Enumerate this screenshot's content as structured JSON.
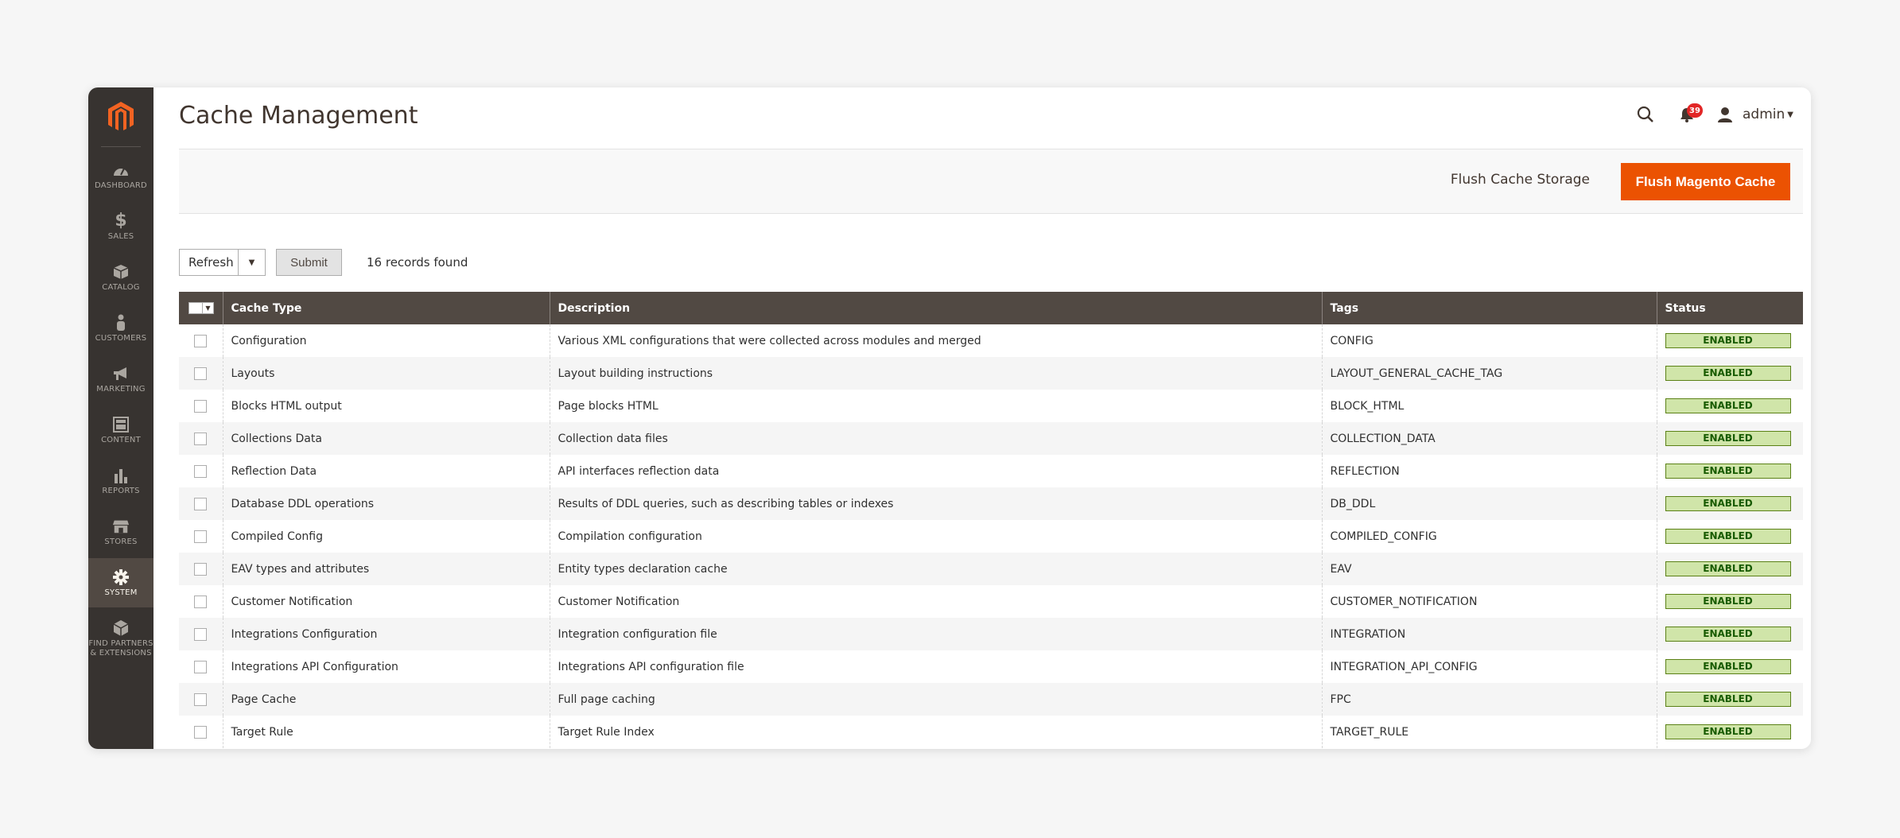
{
  "page": {
    "title": "Cache Management"
  },
  "header": {
    "notifications_count": "39",
    "user_name": "admin"
  },
  "sidebar": {
    "items": [
      {
        "label": "DASHBOARD",
        "icon": "dashboard-icon"
      },
      {
        "label": "SALES",
        "icon": "dollar-icon"
      },
      {
        "label": "CATALOG",
        "icon": "box-icon"
      },
      {
        "label": "CUSTOMERS",
        "icon": "person-icon"
      },
      {
        "label": "MARKETING",
        "icon": "megaphone-icon"
      },
      {
        "label": "CONTENT",
        "icon": "layout-icon"
      },
      {
        "label": "REPORTS",
        "icon": "bar-chart-icon"
      },
      {
        "label": "STORES",
        "icon": "store-icon"
      },
      {
        "label": "SYSTEM",
        "icon": "gear-icon",
        "active": true
      },
      {
        "label": "FIND PARTNERS\n& EXTENSIONS",
        "icon": "cube-icon"
      }
    ]
  },
  "actions": {
    "flush_storage": "Flush Cache Storage",
    "flush_magento": "Flush Magento Cache"
  },
  "mass_action": {
    "selected": "Refresh",
    "submit": "Submit",
    "records": "16 records found"
  },
  "grid": {
    "columns": [
      "Cache Type",
      "Description",
      "Tags",
      "Status"
    ],
    "rows": [
      {
        "type": "Configuration",
        "description": "Various XML configurations that were collected across modules and merged",
        "tags": "CONFIG",
        "status": "ENABLED"
      },
      {
        "type": "Layouts",
        "description": "Layout building instructions",
        "tags": "LAYOUT_GENERAL_CACHE_TAG",
        "status": "ENABLED"
      },
      {
        "type": "Blocks HTML output",
        "description": "Page blocks HTML",
        "tags": "BLOCK_HTML",
        "status": "ENABLED"
      },
      {
        "type": "Collections Data",
        "description": "Collection data files",
        "tags": "COLLECTION_DATA",
        "status": "ENABLED"
      },
      {
        "type": "Reflection Data",
        "description": "API interfaces reflection data",
        "tags": "REFLECTION",
        "status": "ENABLED"
      },
      {
        "type": "Database DDL operations",
        "description": "Results of DDL queries, such as describing tables or indexes",
        "tags": "DB_DDL",
        "status": "ENABLED"
      },
      {
        "type": "Compiled Config",
        "description": "Compilation configuration",
        "tags": "COMPILED_CONFIG",
        "status": "ENABLED"
      },
      {
        "type": "EAV types and attributes",
        "description": "Entity types declaration cache",
        "tags": "EAV",
        "status": "ENABLED"
      },
      {
        "type": "Customer Notification",
        "description": "Customer Notification",
        "tags": "CUSTOMER_NOTIFICATION",
        "status": "ENABLED"
      },
      {
        "type": "Integrations Configuration",
        "description": "Integration configuration file",
        "tags": "INTEGRATION",
        "status": "ENABLED"
      },
      {
        "type": "Integrations API Configuration",
        "description": "Integrations API configuration file",
        "tags": "INTEGRATION_API_CONFIG",
        "status": "ENABLED"
      },
      {
        "type": "Page Cache",
        "description": "Full page caching",
        "tags": "FPC",
        "status": "ENABLED"
      },
      {
        "type": "Target Rule",
        "description": "Target Rule Index",
        "tags": "TARGET_RULE",
        "status": "ENABLED"
      }
    ]
  },
  "colors": {
    "accent": "#eb5202",
    "sidebar_bg": "#373330",
    "header_bg": "#514943",
    "status_bg": "#d0e5a9"
  }
}
